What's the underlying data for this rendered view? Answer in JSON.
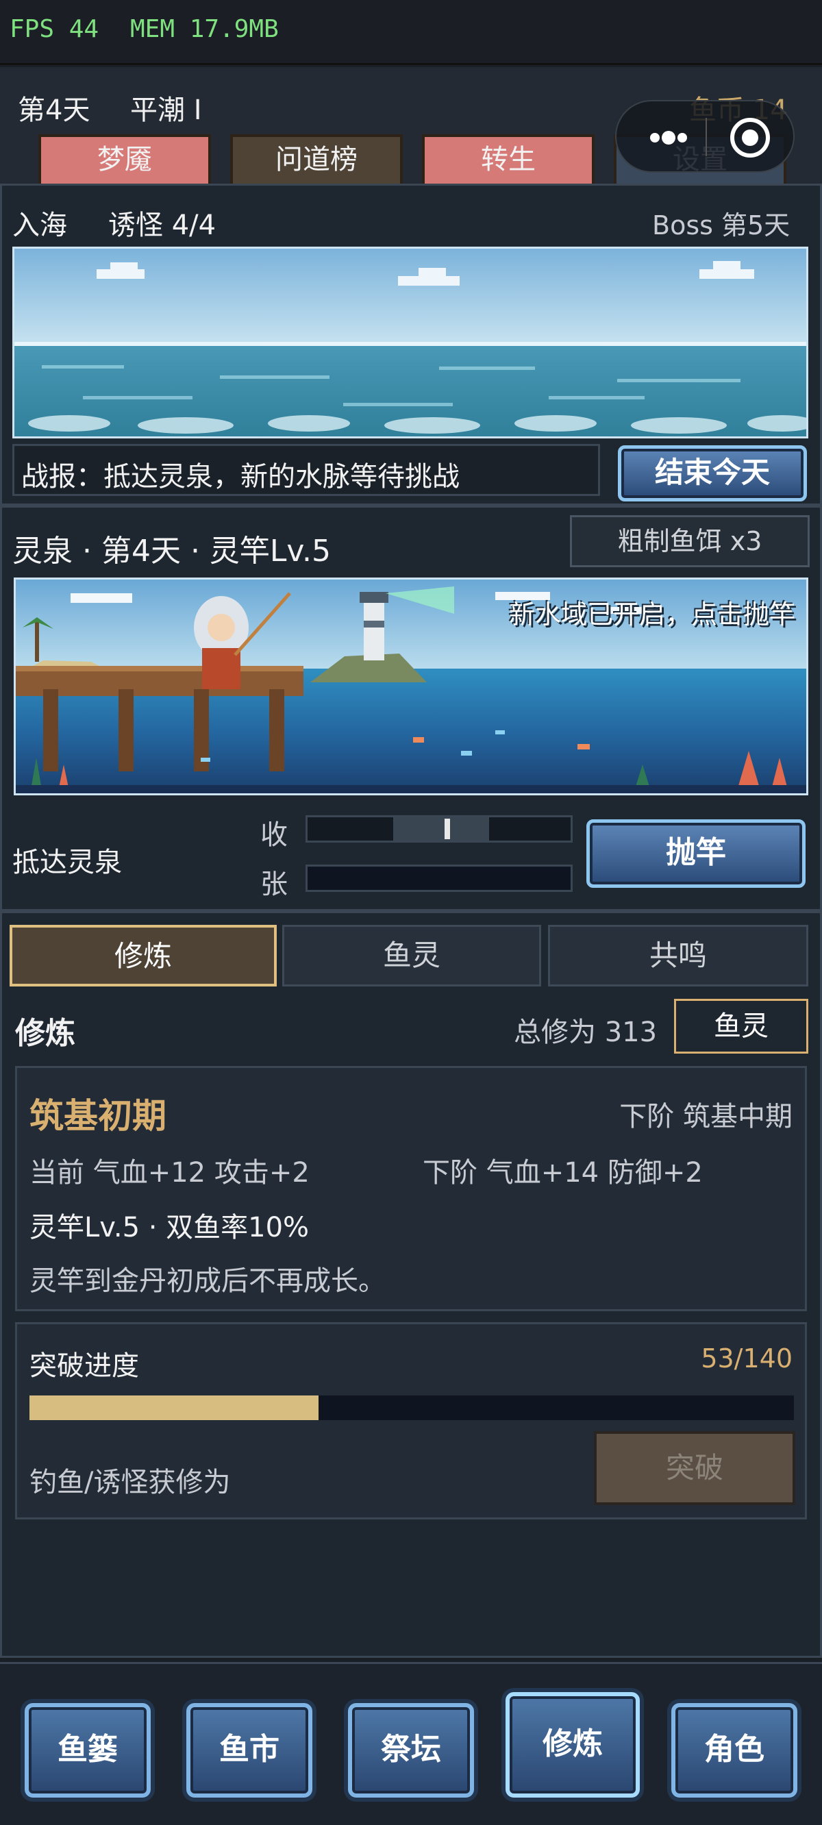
{
  "status": {
    "fps": "FPS 44",
    "mem": "MEM 17.9MB"
  },
  "header": {
    "day": "第4天",
    "tide": "平潮 I",
    "coin_label": "鱼币 14",
    "tabs": [
      "梦魇",
      "问道榜",
      "转生",
      "设置"
    ]
  },
  "sea": {
    "mode": "入海",
    "lure": "诱怪 4/4",
    "boss": "Boss 第5天",
    "report": "战报：抵达灵泉，新的水脉等待挑战",
    "end_day_button": "结束今天"
  },
  "fishing": {
    "title": "灵泉 · 第4天 · 灵竿Lv.5",
    "bait": "粗制鱼饵 x3",
    "banner_text": "新水域已开启，点击抛竿",
    "location": "抵达灵泉",
    "reel_label": "收",
    "tension_label": "张",
    "cast_button": "抛竿",
    "reel_marker_fraction": 0.53
  },
  "subtabs": [
    "修炼",
    "鱼灵",
    "共鸣"
  ],
  "cultivation": {
    "heading": "修炼",
    "total": "总修为 313",
    "spirit_button": "鱼灵",
    "realm": "筑基初期",
    "next_realm": "下阶 筑基中期",
    "current_stats": "当前 气血+12 攻击+2",
    "next_stats": "下阶 气血+14 防御+2",
    "rod_info": "灵竿Lv.5 · 双鱼率10%",
    "note": "灵竿到金丹初成后不再成长。"
  },
  "breakthrough": {
    "title": "突破进度",
    "progress_text": "53/140",
    "progress": 53,
    "max": 140,
    "hint": "钓鱼/诱怪获修为",
    "button": "突破"
  },
  "nav": [
    "鱼篓",
    "鱼市",
    "祭坛",
    "修炼",
    "角色"
  ],
  "colors": {
    "gold": "#d9b070",
    "progress_fill": "#d8bd80",
    "tab_red": "#d67a78"
  }
}
